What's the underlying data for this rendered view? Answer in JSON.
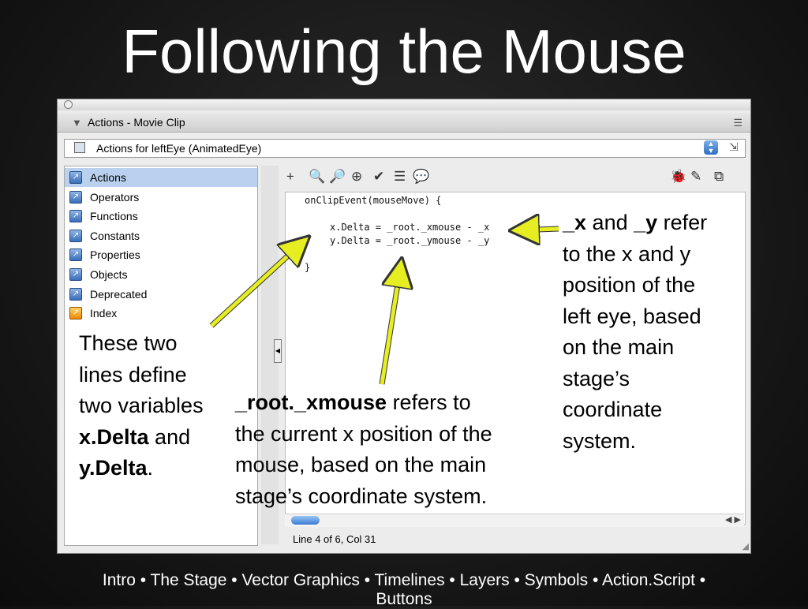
{
  "slide": {
    "title": "Following the Mouse"
  },
  "window": {
    "panel_title": "Actions - Movie Clip",
    "target_label": "Actions for leftEye (AnimatedEye)",
    "status": "Line 4 of 6, Col 31"
  },
  "toolbox": {
    "items": [
      {
        "label": "Actions",
        "icon": "arrow-book-icon",
        "selected": true
      },
      {
        "label": "Operators",
        "icon": "arrow-book-icon"
      },
      {
        "label": "Functions",
        "icon": "arrow-book-icon"
      },
      {
        "label": "Constants",
        "icon": "arrow-book-icon"
      },
      {
        "label": "Properties",
        "icon": "arrow-book-icon"
      },
      {
        "label": "Objects",
        "icon": "arrow-book-icon"
      },
      {
        "label": "Deprecated",
        "icon": "arrow-book-icon"
      },
      {
        "label": "Index",
        "icon": "index-book-icon"
      }
    ]
  },
  "toolbar": {
    "tools": [
      "+",
      "🔍",
      "🔎",
      "⊕",
      "✔",
      "☰",
      "💬"
    ],
    "right_tools": [
      "🐞",
      "✎",
      "⧉"
    ]
  },
  "code": {
    "lines": [
      "onClipEvent(mouseMove) {",
      "x.Delta = _root._xmouse - _x",
      "y.Delta = _root._ymouse - _y",
      "}"
    ]
  },
  "notes": {
    "left": {
      "line1": "These two",
      "line2": "lines define",
      "line3": "two variables",
      "line4_bold": "x.Delta",
      "line4_rest": " and",
      "line5_bold": "y.Delta",
      "line5_rest": "."
    },
    "middle": {
      "line1_bold": "_root._xmouse",
      "line1_rest": " refers to",
      "line2": "the current x position of the",
      "line3": "mouse, based on the main",
      "line4": "stage’s coordinate system."
    },
    "right": {
      "line1_bold_a": "_x",
      "line1_mid": " and ",
      "line1_bold_b": "_y",
      "line1_rest": " refer",
      "line2": "to the x and y",
      "line3": "position of the",
      "line4": "left eye, based",
      "line5": "on the main",
      "line6": "stage’s",
      "line7": "coordinate",
      "line8": "system."
    }
  },
  "footer": {
    "line1": "Intro • The Stage • Vector Graphics • Timelines • Layers • Symbols • Action.Script •",
    "line2": "Buttons"
  },
  "colors": {
    "arrow": "#e6ee22",
    "selection": "#b9d0ee"
  }
}
